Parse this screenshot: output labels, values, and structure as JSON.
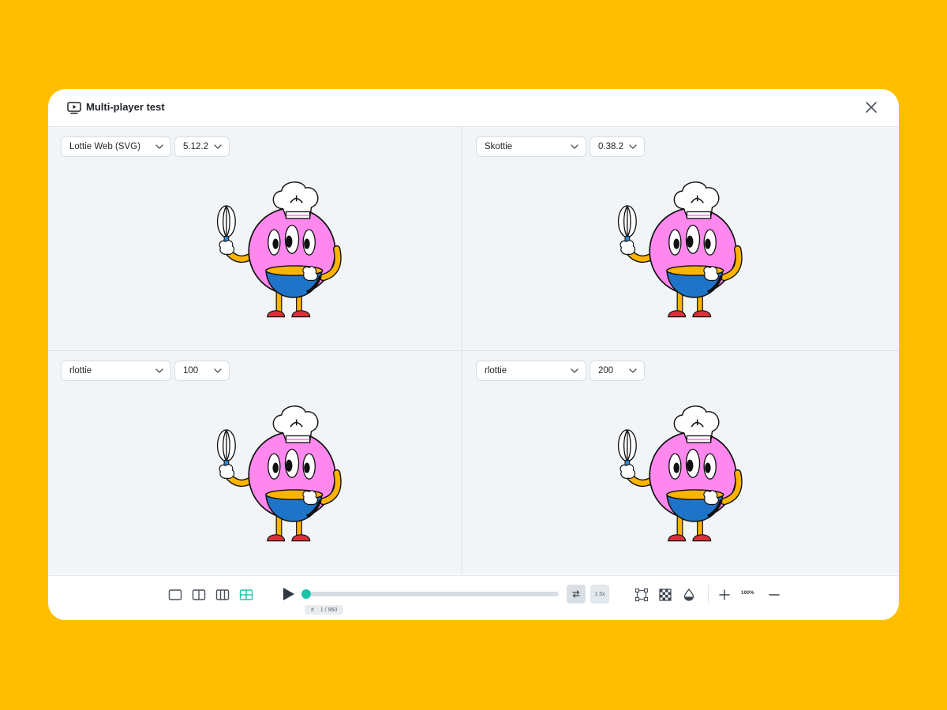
{
  "window": {
    "title": "Multi-player test"
  },
  "players": [
    {
      "player": "Lottie Web (SVG)",
      "version": "5.12.2"
    },
    {
      "player": "Skottie",
      "version": "0.38.2"
    },
    {
      "player": "rlottie",
      "version": "100"
    },
    {
      "player": "rlottie",
      "version": "200"
    }
  ],
  "toolbar": {
    "frame_symbol": "#",
    "frame_counter": "1 / 960",
    "speed": "1.5x",
    "zoom": "100%",
    "progress": 0
  },
  "colors": {
    "background": "#FFBF00",
    "accent": "#19C5A6",
    "panel": "#F2F5F8"
  },
  "icons": [
    "screen-play-icon",
    "close-icon",
    "chevron-down-icon",
    "layout-single-icon",
    "layout-two-icon",
    "layout-three-icon",
    "layout-grid-icon",
    "play-icon",
    "loop-icon",
    "bounding-box-icon",
    "checkerboard-icon",
    "drop-icon",
    "zoom-in-icon",
    "zoom-out-icon"
  ]
}
